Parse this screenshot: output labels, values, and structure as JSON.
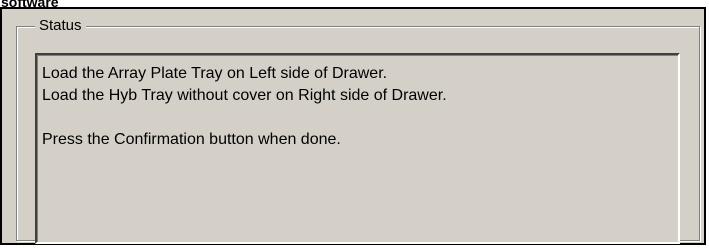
{
  "header": {
    "cutoff_label": "software"
  },
  "status_group": {
    "title": "Status",
    "lines": [
      "Load the Array Plate Tray on Left side of Drawer.",
      "Load the Hyb Tray without cover on Right side of Drawer.",
      "",
      "Press the Confirmation button when done."
    ]
  }
}
